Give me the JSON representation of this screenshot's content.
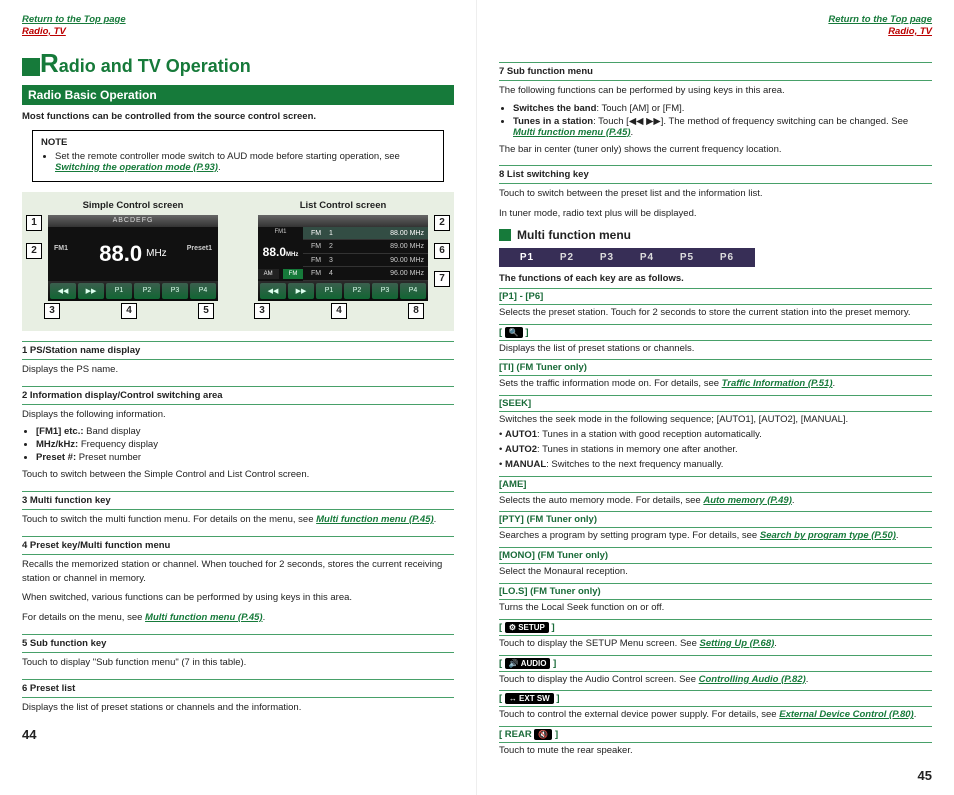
{
  "header": {
    "return_link": "Return to the Top page",
    "section": "Radio, TV"
  },
  "title": "adio and TV Operation",
  "basic_section": "Radio Basic Operation",
  "intro": "Most functions can be controlled from the source control screen.",
  "note": {
    "label": "NOTE",
    "line_a": "Set the remote controller mode switch to AUD mode before starting operation, see ",
    "line_link": "Switching the operation mode (P.93)"
  },
  "screens": {
    "simple_title": "Simple Control screen",
    "list_title": "List Control screen",
    "simple": {
      "top": "ABCDEFG",
      "fm": "FM1",
      "preset": "Preset1",
      "freq": "88.0",
      "unit": "MHz"
    },
    "list": {
      "left_fm": "FM1",
      "left_freq": "88.0",
      "left_unit": "MHz",
      "am": "AM",
      "fmb": "FM",
      "rows": [
        {
          "band": "FM",
          "idx": "1",
          "freq": "88.00 MHz"
        },
        {
          "band": "FM",
          "idx": "2",
          "freq": "89.00 MHz"
        },
        {
          "band": "FM",
          "idx": "3",
          "freq": "90.00 MHz"
        },
        {
          "band": "FM",
          "idx": "4",
          "freq": "96.00 MHz"
        }
      ]
    },
    "callouts_simple": [
      "1",
      "2",
      "3",
      "4",
      "5"
    ],
    "callouts_list": [
      "2",
      "6",
      "7",
      "3",
      "4",
      "8"
    ]
  },
  "items": [
    {
      "head": "1  PS/Station name display",
      "body": [
        "Displays the PS name."
      ]
    },
    {
      "head": "2  Information display/Control switching area",
      "body": [
        "Displays the following information."
      ],
      "bullets": [
        "[FM1] etc.: Band display",
        "MHz/kHz: Frequency display",
        "Preset #: Preset number"
      ],
      "body2": [
        "Touch to switch between the Simple Control and List Control screen."
      ]
    },
    {
      "head": "3  Multi function key",
      "body_prefix": "Touch to switch the multi function menu. For details on the menu, see ",
      "body_link": "Multi function menu (P.45)"
    },
    {
      "head": "4  Preset key/Multi function menu",
      "body": [
        "Recalls the memorized station or channel. When touched for 2 seconds, stores the current receiving station or channel in memory.",
        "When switched, various functions can be performed by using keys in this area."
      ],
      "body_prefix2": "For details on the menu, see ",
      "body_link2": "Multi function menu (P.45)"
    },
    {
      "head": "5  Sub function key",
      "body": [
        "Touch to display \"Sub function menu\" (7 in this table)."
      ]
    },
    {
      "head": "6  Preset list",
      "body": [
        "Displays the list of preset stations or channels and the information."
      ]
    }
  ],
  "right": {
    "sub7_head": "7  Sub function menu",
    "sub7_intro": "The following functions can be performed by using keys in this area.",
    "sub7_b1": "Switches the band: Touch [AM] or [FM].",
    "sub7_b2_prefix": "Tunes in a station: Touch [",
    "sub7_b2_suffix": "]. The method of frequency switching can be changed. See ",
    "sub7_b2_link": "Multi function menu (P.45)",
    "sub7_bar": "The bar in center (tuner only) shows the current frequency location.",
    "sub8_head": "8  List switching key",
    "sub8_a": "Touch to switch between the preset list and the information list.",
    "sub8_b": "In tuner mode, radio text plus will be displayed.",
    "mfm_head": "Multi function menu",
    "presets": [
      "P1",
      "P2",
      "P3",
      "P4",
      "P5",
      "P6"
    ],
    "functions_intro": "The functions of each key are as follows.",
    "keys": [
      {
        "label": "[P1] - [P6]",
        "desc": "Selects the preset station. Touch for 2 seconds to store the current station into the preset memory."
      },
      {
        "label": "[ 🔍 ]",
        "desc": "Displays the list of preset stations or channels."
      },
      {
        "label": "[TI] (FM Tuner only)",
        "desc_prefix": "Sets the traffic information mode on. For details, see ",
        "link": "Traffic Information (P.51)"
      },
      {
        "label": "[SEEK]",
        "desc": "Switches the seek mode in the following sequence; [AUTO1], [AUTO2], [MANUAL].",
        "bullets": [
          "AUTO1: Tunes in a station with good reception automatically.",
          "AUTO2: Tunes in stations in memory one after another.",
          "MANUAL: Switches to the next frequency manually."
        ]
      },
      {
        "label": "[AME]",
        "desc_prefix": "Selects the auto memory mode. For details, see ",
        "link": "Auto memory (P.49)"
      },
      {
        "label": "[PTY] (FM Tuner only)",
        "desc_prefix": "Searches a program by setting program type. For details, see ",
        "link": "Search by program type (P.50)"
      },
      {
        "label": "[MONO] (FM Tuner only)",
        "desc": "Select the Monaural reception."
      },
      {
        "label": "[LO.S] (FM Tuner only)",
        "desc": "Turns the Local Seek function on or off."
      },
      {
        "label_prefix": "[ ",
        "chip": "⚙ SETUP",
        "label_suffix": " ]",
        "desc_prefix": "Touch to display the SETUP Menu screen. See ",
        "link": "Setting Up (P.68)"
      },
      {
        "label_prefix": "[ ",
        "chip": "🔊 AUDIO",
        "label_suffix": " ]",
        "desc_prefix": "Touch to display the Audio Control screen. See ",
        "link": "Controlling Audio (P.82)"
      },
      {
        "label_prefix": "[ ",
        "chip": "↔ EXT SW",
        "label_suffix": " ]",
        "desc_prefix": "Touch to control the external device power supply. For details, see ",
        "link": "External Device Control (P.80)"
      },
      {
        "label_prefix": "[ REAR ",
        "chip": "🔇",
        "label_suffix": " ]",
        "desc": "Touch to mute the rear speaker."
      }
    ]
  },
  "page_left": "44",
  "page_right": "45"
}
